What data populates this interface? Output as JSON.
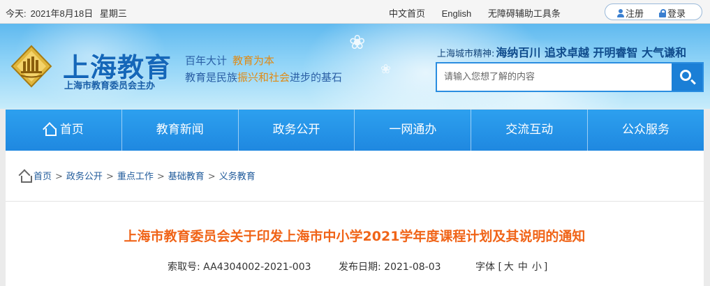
{
  "topbar": {
    "date_label": "今天:",
    "date": "2021年8月18日",
    "weekday": "星期三",
    "links": [
      "中文首页",
      "English",
      "无障碍辅助工具条"
    ],
    "register": "注册",
    "login": "登录"
  },
  "header": {
    "site_title": "上海教育",
    "site_sub": "上海市教育委员会主办",
    "slogan1_a": "百年大计",
    "slogan1_b": "教育为本",
    "slogan2_a": "教育是民族",
    "slogan2_b": "振兴和社会",
    "slogan2_c": "进步的基石",
    "spirit_label": "上海城市精神:",
    "spirit": "海纳百川 追求卓越 开明睿智 大气谦和",
    "search_placeholder": "请输入您想了解的内容"
  },
  "nav": {
    "items": [
      "首页",
      "教育新闻",
      "政务公开",
      "一网通办",
      "交流互动",
      "公众服务"
    ]
  },
  "breadcrumb": [
    "首页",
    "政务公开",
    "重点工作",
    "基础教育",
    "义务教育"
  ],
  "article": {
    "title": "上海市教育委员会关于印发上海市中小学2021学年度课程计划及其说明的通知",
    "index_label": "索取号:",
    "index_value": "AA4304002-2021-003",
    "date_label": "发布日期:",
    "date_value": "2021-08-03",
    "font_label": "字体",
    "font_open": "[",
    "font_large": "大",
    "font_medium": "中",
    "font_small": "小",
    "font_close": "]"
  },
  "colors": {
    "nav_blue": "#2196e8",
    "title_orange": "#f06418",
    "brand_blue": "#1567b9"
  }
}
